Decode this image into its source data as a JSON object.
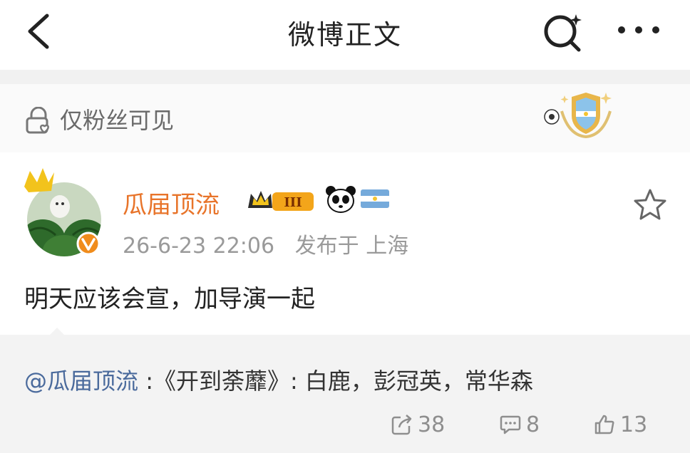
{
  "header": {
    "title": "微博正文"
  },
  "visibility": {
    "label": "仅粉丝可见"
  },
  "post": {
    "author": "瓜届顶流",
    "time": "26-6-23 22:06",
    "location": "发布于 上海",
    "text": "明天应该会宣，加导演一起",
    "badge_level": "III"
  },
  "repost": {
    "mention": "@瓜届顶流",
    "content": " :《开到荼蘼》: 白鹿，彭冠英，常华森"
  },
  "stats": {
    "reposts": "38",
    "comments": "8",
    "likes": "13"
  },
  "colors": {
    "username": "#e8742a",
    "mention": "#4a6a9c",
    "verified": "#f08c1c"
  },
  "icons": [
    "back-icon",
    "search-icon",
    "more-icon",
    "lock-icon",
    "shield-badge-icon",
    "crown-icon",
    "panda-icon",
    "flag-icon",
    "star-icon",
    "repost-icon",
    "comment-icon",
    "like-icon"
  ]
}
